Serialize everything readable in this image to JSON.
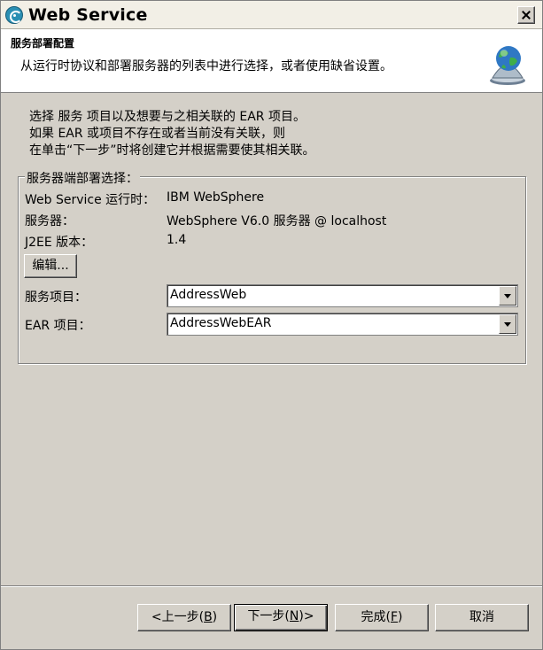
{
  "window": {
    "title": "Web Service"
  },
  "banner": {
    "title": "服务部署配置",
    "description": "从运行时协议和部署服务器的列表中进行选择，或者使用缺省设置。"
  },
  "intro": {
    "line1": "选择 服务 项目以及想要与之相关联的 EAR 项目。",
    "line2": "如果 EAR 或项目不存在或者当前没有关联，则",
    "line3": "在单击“下一步”时将创建它并根据需要使其相关联。"
  },
  "server_group": {
    "legend": "服务器端部署选择：",
    "runtime_label": "Web Service 运行时：",
    "runtime_value": "IBM WebSphere",
    "server_label": "服务器：",
    "server_value": "WebSphere V6.0 服务器 @ localhost",
    "j2ee_label": "J2EE 版本：",
    "j2ee_value": "1.4",
    "edit_button": "编辑...",
    "service_project_label": "服务项目：",
    "service_project_value": "AddressWeb",
    "ear_project_label": "EAR 项目：",
    "ear_project_value": "AddressWebEAR"
  },
  "buttons": {
    "back_prefix": "<上一步(",
    "back_mnemonic": "B",
    "back_suffix": ")",
    "next_prefix": "下一步(",
    "next_mnemonic": "N",
    "next_suffix": ")>",
    "finish_prefix": "完成(",
    "finish_mnemonic": "F",
    "finish_suffix": ")",
    "cancel": "取消"
  },
  "icons": {
    "app": "web-service-icon",
    "banner": "globe-service-icon",
    "close": "close-icon"
  }
}
